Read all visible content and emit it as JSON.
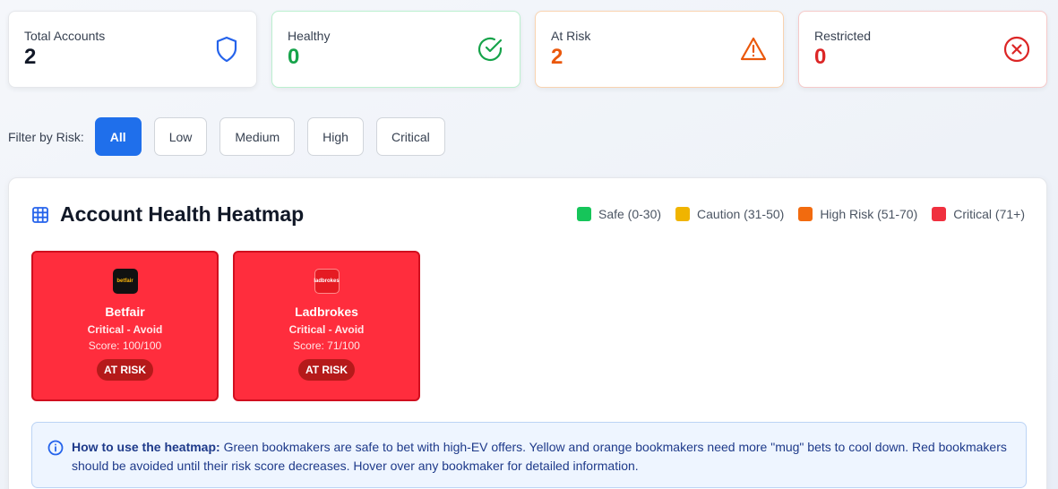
{
  "stats": [
    {
      "label": "Total Accounts",
      "value": "2",
      "color": "#111827",
      "icon": "shield-icon"
    },
    {
      "label": "Healthy",
      "value": "0",
      "color": "#16a34a",
      "icon": "check-circle-icon"
    },
    {
      "label": "At Risk",
      "value": "2",
      "color": "#ea580c",
      "icon": "warning-triangle-icon"
    },
    {
      "label": "Restricted",
      "value": "0",
      "color": "#dc2626",
      "icon": "x-circle-icon"
    }
  ],
  "filter": {
    "label": "Filter by Risk:",
    "options": [
      "All",
      "Low",
      "Medium",
      "High",
      "Critical"
    ],
    "selected": "All"
  },
  "heatmap": {
    "title": "Account Health Heatmap",
    "legend": [
      {
        "label": "Safe (0-30)",
        "color": "#16c55a"
      },
      {
        "label": "Caution (31-50)",
        "color": "#f0b400"
      },
      {
        "label": "High Risk (51-70)",
        "color": "#f26b0f"
      },
      {
        "label": "Critical (71+)",
        "color": "#f0303f"
      }
    ],
    "cards": [
      {
        "logo_text": "betfair",
        "name": "Betfair",
        "status": "Critical - Avoid",
        "score": "Score: 100/100",
        "badge": "AT RISK"
      },
      {
        "logo_text": "ladbrokes",
        "name": "Ladbrokes",
        "status": "Critical - Avoid",
        "score": "Score: 71/100",
        "badge": "AT RISK"
      }
    ]
  },
  "info": {
    "heading": "How to use the heatmap:",
    "text": " Green bookmakers are safe to bet with high-EV offers. Yellow and orange bookmakers need more \"mug\" bets to cool down. Red bookmakers should be avoided until their risk score decreases. Hover over any bookmaker for detailed information."
  }
}
